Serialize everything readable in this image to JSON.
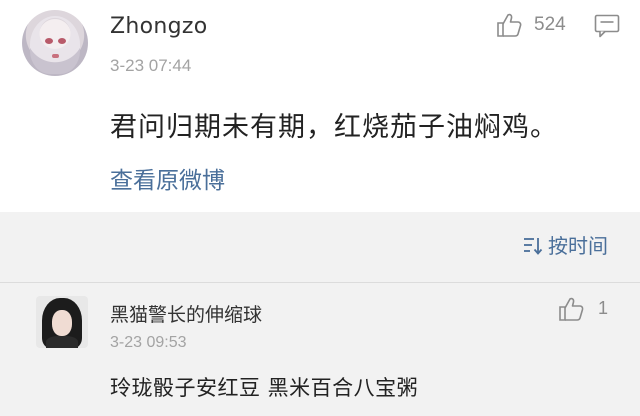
{
  "comment": {
    "username": "Zhongzo",
    "timestamp": "3-23 07:44",
    "like_count": "524",
    "text": "君问归期未有期，红烧茄子油焖鸡。",
    "view_original_label": "查看原微博"
  },
  "replies_section": {
    "sort_label": "按时间",
    "replies": [
      {
        "username": "黑猫警长的伸缩球",
        "timestamp": "3-23 09:53",
        "like_count": "1",
        "text": "玲珑骰子安红豆 黑米百合八宝粥"
      }
    ]
  },
  "icons": {
    "like": "thumbs-up-icon",
    "reply": "comment-icon",
    "sort": "sort-icon"
  },
  "colors": {
    "link": "#4a6f9a",
    "muted": "#a3a3a3",
    "replies_background": "#f2f2f2"
  }
}
